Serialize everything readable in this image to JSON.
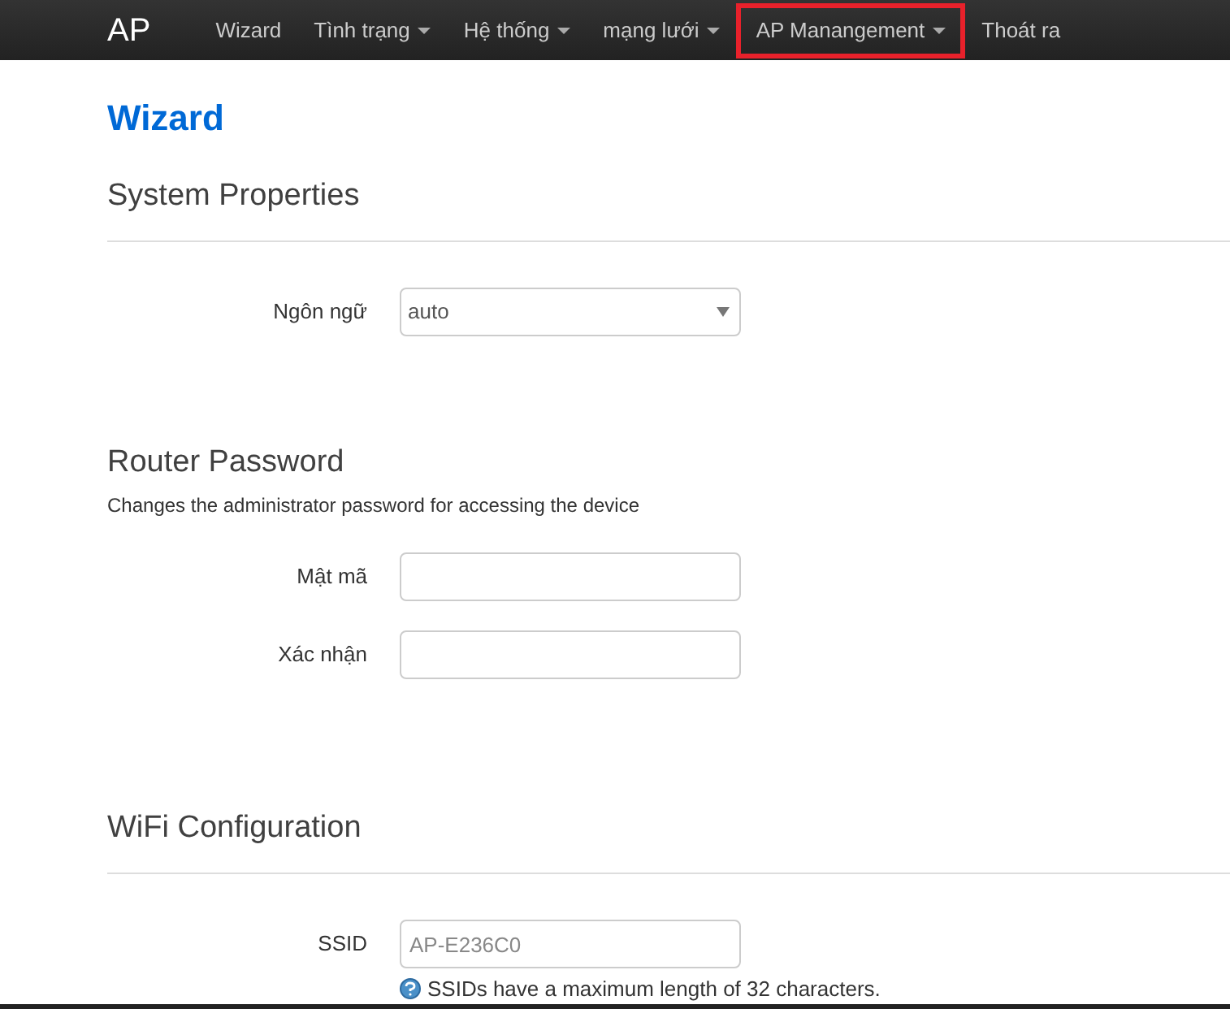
{
  "navbar": {
    "brand": "AP",
    "items": [
      {
        "label": "Wizard",
        "dropdown": false,
        "highlighted": false
      },
      {
        "label": "Tình trạng",
        "dropdown": true,
        "highlighted": false
      },
      {
        "label": "Hệ thống",
        "dropdown": true,
        "highlighted": false
      },
      {
        "label": "mạng lưới",
        "dropdown": true,
        "highlighted": false
      },
      {
        "label": "AP Manangement",
        "dropdown": true,
        "highlighted": true
      },
      {
        "label": "Thoát ra",
        "dropdown": false,
        "highlighted": false
      }
    ]
  },
  "page_title": "Wizard",
  "sections": [
    {
      "title": "System Properties",
      "divider": true,
      "fields": [
        {
          "kind": "select",
          "label": "Ngôn ngữ",
          "value": "auto"
        }
      ]
    },
    {
      "title": "Router Password",
      "divider": false,
      "description": "Changes the administrator password for accessing the device",
      "fields": [
        {
          "kind": "password",
          "label": "Mật mã"
        },
        {
          "kind": "password",
          "label": "Xác nhận"
        }
      ]
    },
    {
      "title": "WiFi Configuration",
      "divider": true,
      "fields": [
        {
          "kind": "text",
          "label": "SSID",
          "placeholder": "AP-E236C0",
          "hint": "SSIDs have a maximum length of 32 characters."
        }
      ]
    }
  ]
}
